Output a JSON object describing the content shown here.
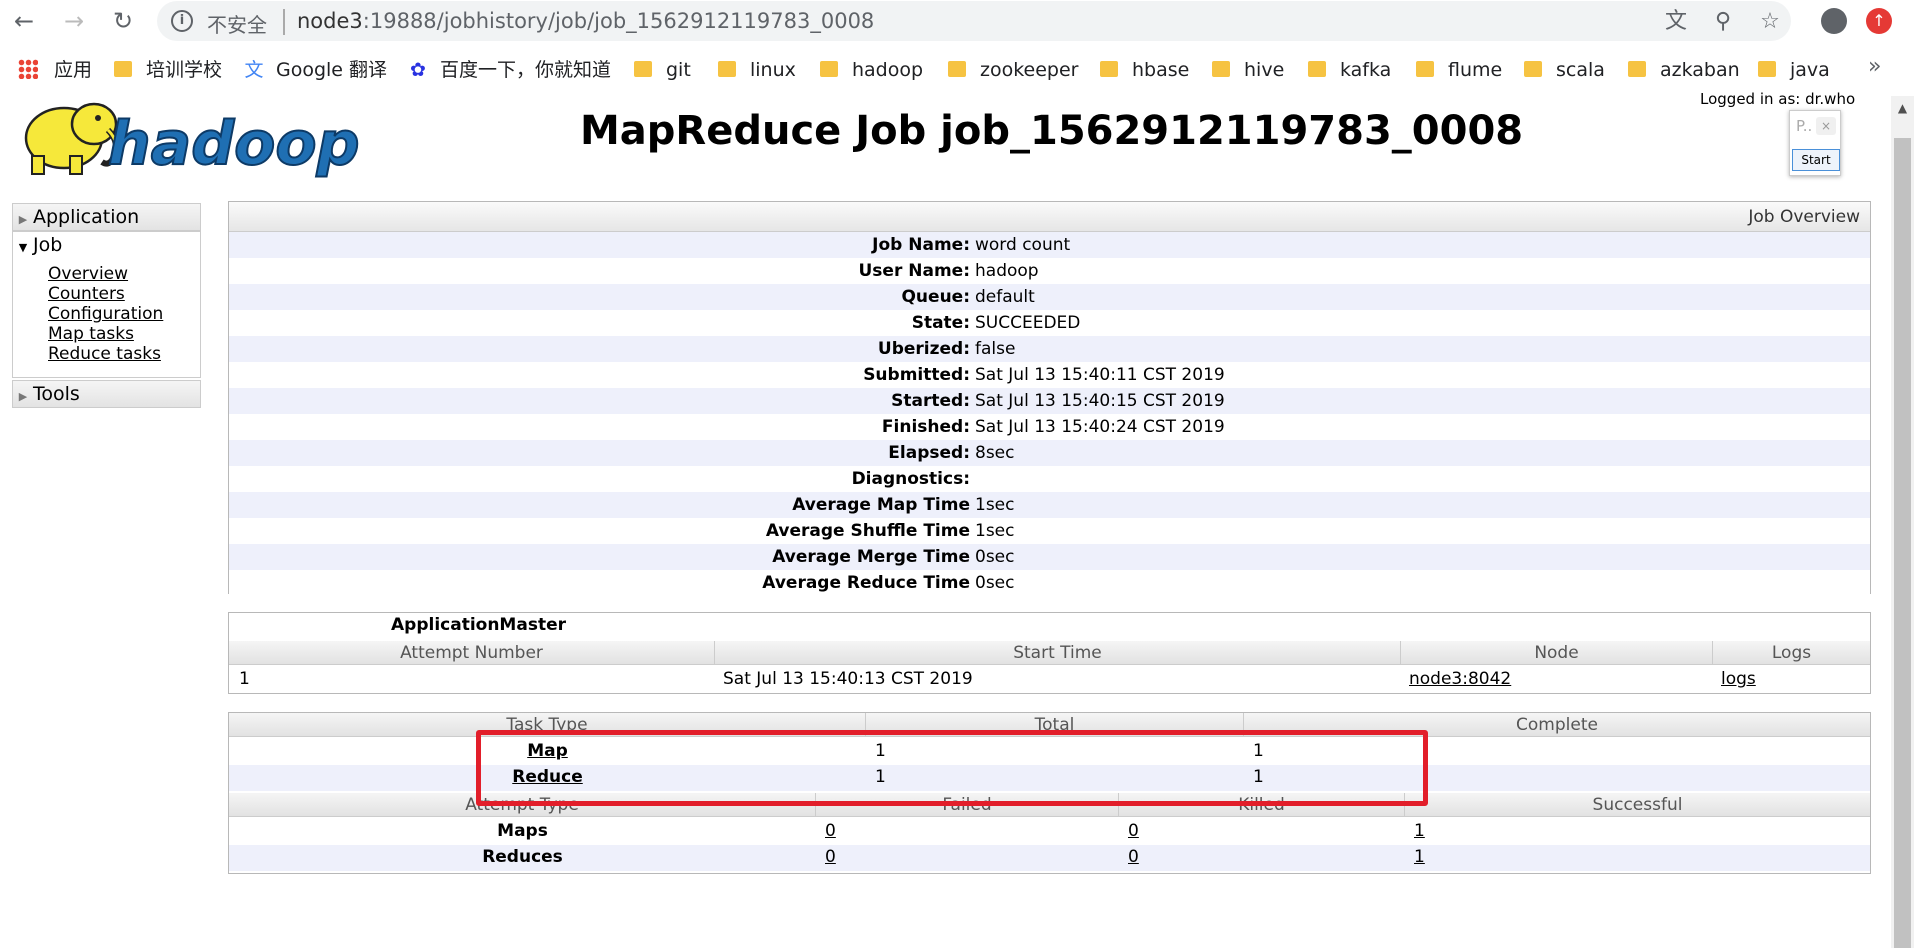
{
  "browser": {
    "insecure_label": "不安全",
    "url_host": "node3",
    "url_rest": ":19888/jobhistory/job/job_1562912119783_0008"
  },
  "bookmarks": [
    {
      "label": "应用",
      "icon": "apps-grid-icon"
    },
    {
      "label": "培训学校",
      "icon": "folder-icon"
    },
    {
      "label": "Google 翻译",
      "icon": "translate-icon"
    },
    {
      "label": "百度一下，你就知道",
      "icon": "baidu-paw-icon"
    },
    {
      "label": "git",
      "icon": "folder-icon"
    },
    {
      "label": "linux",
      "icon": "folder-icon"
    },
    {
      "label": "hadoop",
      "icon": "folder-icon"
    },
    {
      "label": "zookeeper",
      "icon": "folder-icon"
    },
    {
      "label": "hbase",
      "icon": "folder-icon"
    },
    {
      "label": "hive",
      "icon": "folder-icon"
    },
    {
      "label": "kafka",
      "icon": "folder-icon"
    },
    {
      "label": "flume",
      "icon": "folder-icon"
    },
    {
      "label": "scala",
      "icon": "folder-icon"
    },
    {
      "label": "azkaban",
      "icon": "folder-icon"
    },
    {
      "label": "java",
      "icon": "folder-icon"
    }
  ],
  "bookmarks_more": "»",
  "header": {
    "logged_in": "Logged in as: dr.who",
    "logo_text": "hadoop",
    "title": "MapReduce Job job_1562912119783_0008"
  },
  "widget": {
    "p_label": "P..",
    "close": "×",
    "start_label": "Start"
  },
  "nav": {
    "application": "Application",
    "job": "Job",
    "job_links": [
      "Overview",
      "Counters",
      "Configuration",
      "Map tasks",
      "Reduce tasks"
    ],
    "tools": "Tools"
  },
  "overview": {
    "heading": "Job Overview",
    "rows": [
      {
        "key": "Job Name:",
        "value": "word count"
      },
      {
        "key": "User Name:",
        "value": "hadoop"
      },
      {
        "key": "Queue:",
        "value": "default"
      },
      {
        "key": "State:",
        "value": "SUCCEEDED"
      },
      {
        "key": "Uberized:",
        "value": "false"
      },
      {
        "key": "Submitted:",
        "value": "Sat Jul 13 15:40:11 CST 2019"
      },
      {
        "key": "Started:",
        "value": "Sat Jul 13 15:40:15 CST 2019"
      },
      {
        "key": "Finished:",
        "value": "Sat Jul 13 15:40:24 CST 2019"
      },
      {
        "key": "Elapsed:",
        "value": "8sec"
      },
      {
        "key": "Diagnostics:",
        "value": ""
      },
      {
        "key": "Average Map Time",
        "value": "1sec"
      },
      {
        "key": "Average Shuffle Time",
        "value": "1sec"
      },
      {
        "key": "Average Merge Time",
        "value": "0sec"
      },
      {
        "key": "Average Reduce Time",
        "value": "0sec"
      }
    ]
  },
  "app_master": {
    "title": "ApplicationMaster",
    "columns": [
      "Attempt Number",
      "Start Time",
      "Node",
      "Logs"
    ],
    "row": {
      "attempt": "1",
      "start_time": "Sat Jul 13 15:40:13 CST 2019",
      "node": "node3:8042",
      "logs": "logs"
    }
  },
  "tasks": {
    "columns": [
      "Task Type",
      "Total",
      "Complete"
    ],
    "rows": [
      {
        "type": "Map",
        "total": "1",
        "complete": "1"
      },
      {
        "type": "Reduce",
        "total": "1",
        "complete": "1"
      }
    ],
    "attempt_columns": [
      "Attempt Type",
      "Failed",
      "Killed",
      "Successful"
    ],
    "attempt_rows": [
      {
        "type": "Maps",
        "failed": "0",
        "killed": "0",
        "successful": "1"
      },
      {
        "type": "Reduces",
        "failed": "0",
        "killed": "0",
        "successful": "1"
      }
    ]
  },
  "colors": {
    "highlight_border": "#e21e2a",
    "row_stripe": "#eef0fb",
    "logo_yellow": "#f6e83a",
    "logo_blue": "#1f6fb3"
  }
}
